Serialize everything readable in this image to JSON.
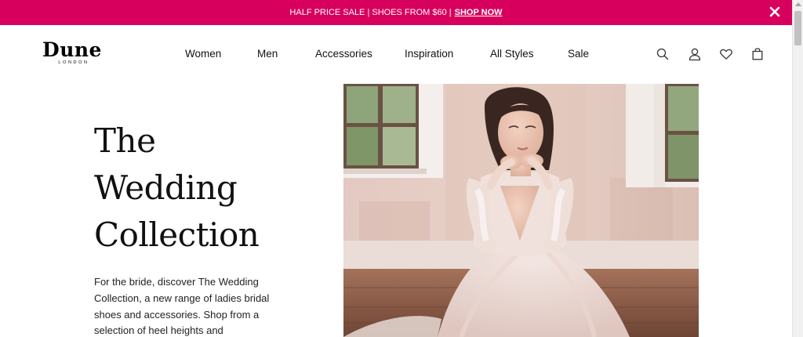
{
  "promo": {
    "text": "HALF PRICE SALE | SHOES FROM $60 |",
    "link": "SHOP NOW",
    "background": "#d8005d"
  },
  "brand": {
    "name": "Dune",
    "sub": "LONDON"
  },
  "nav": {
    "items": [
      "Women",
      "Men",
      "Accessories",
      "Inspiration",
      "All Styles",
      "Sale"
    ]
  },
  "header_icons": [
    "search-icon",
    "account-icon",
    "wishlist-icon",
    "bag-icon"
  ],
  "hero": {
    "title_lines": [
      "The",
      "Wedding",
      "Collection"
    ],
    "body": "For the bride, discover The Wedding Collection, a new range of ladies bridal shoes and accessories. Shop from a selection of heel heights and"
  }
}
